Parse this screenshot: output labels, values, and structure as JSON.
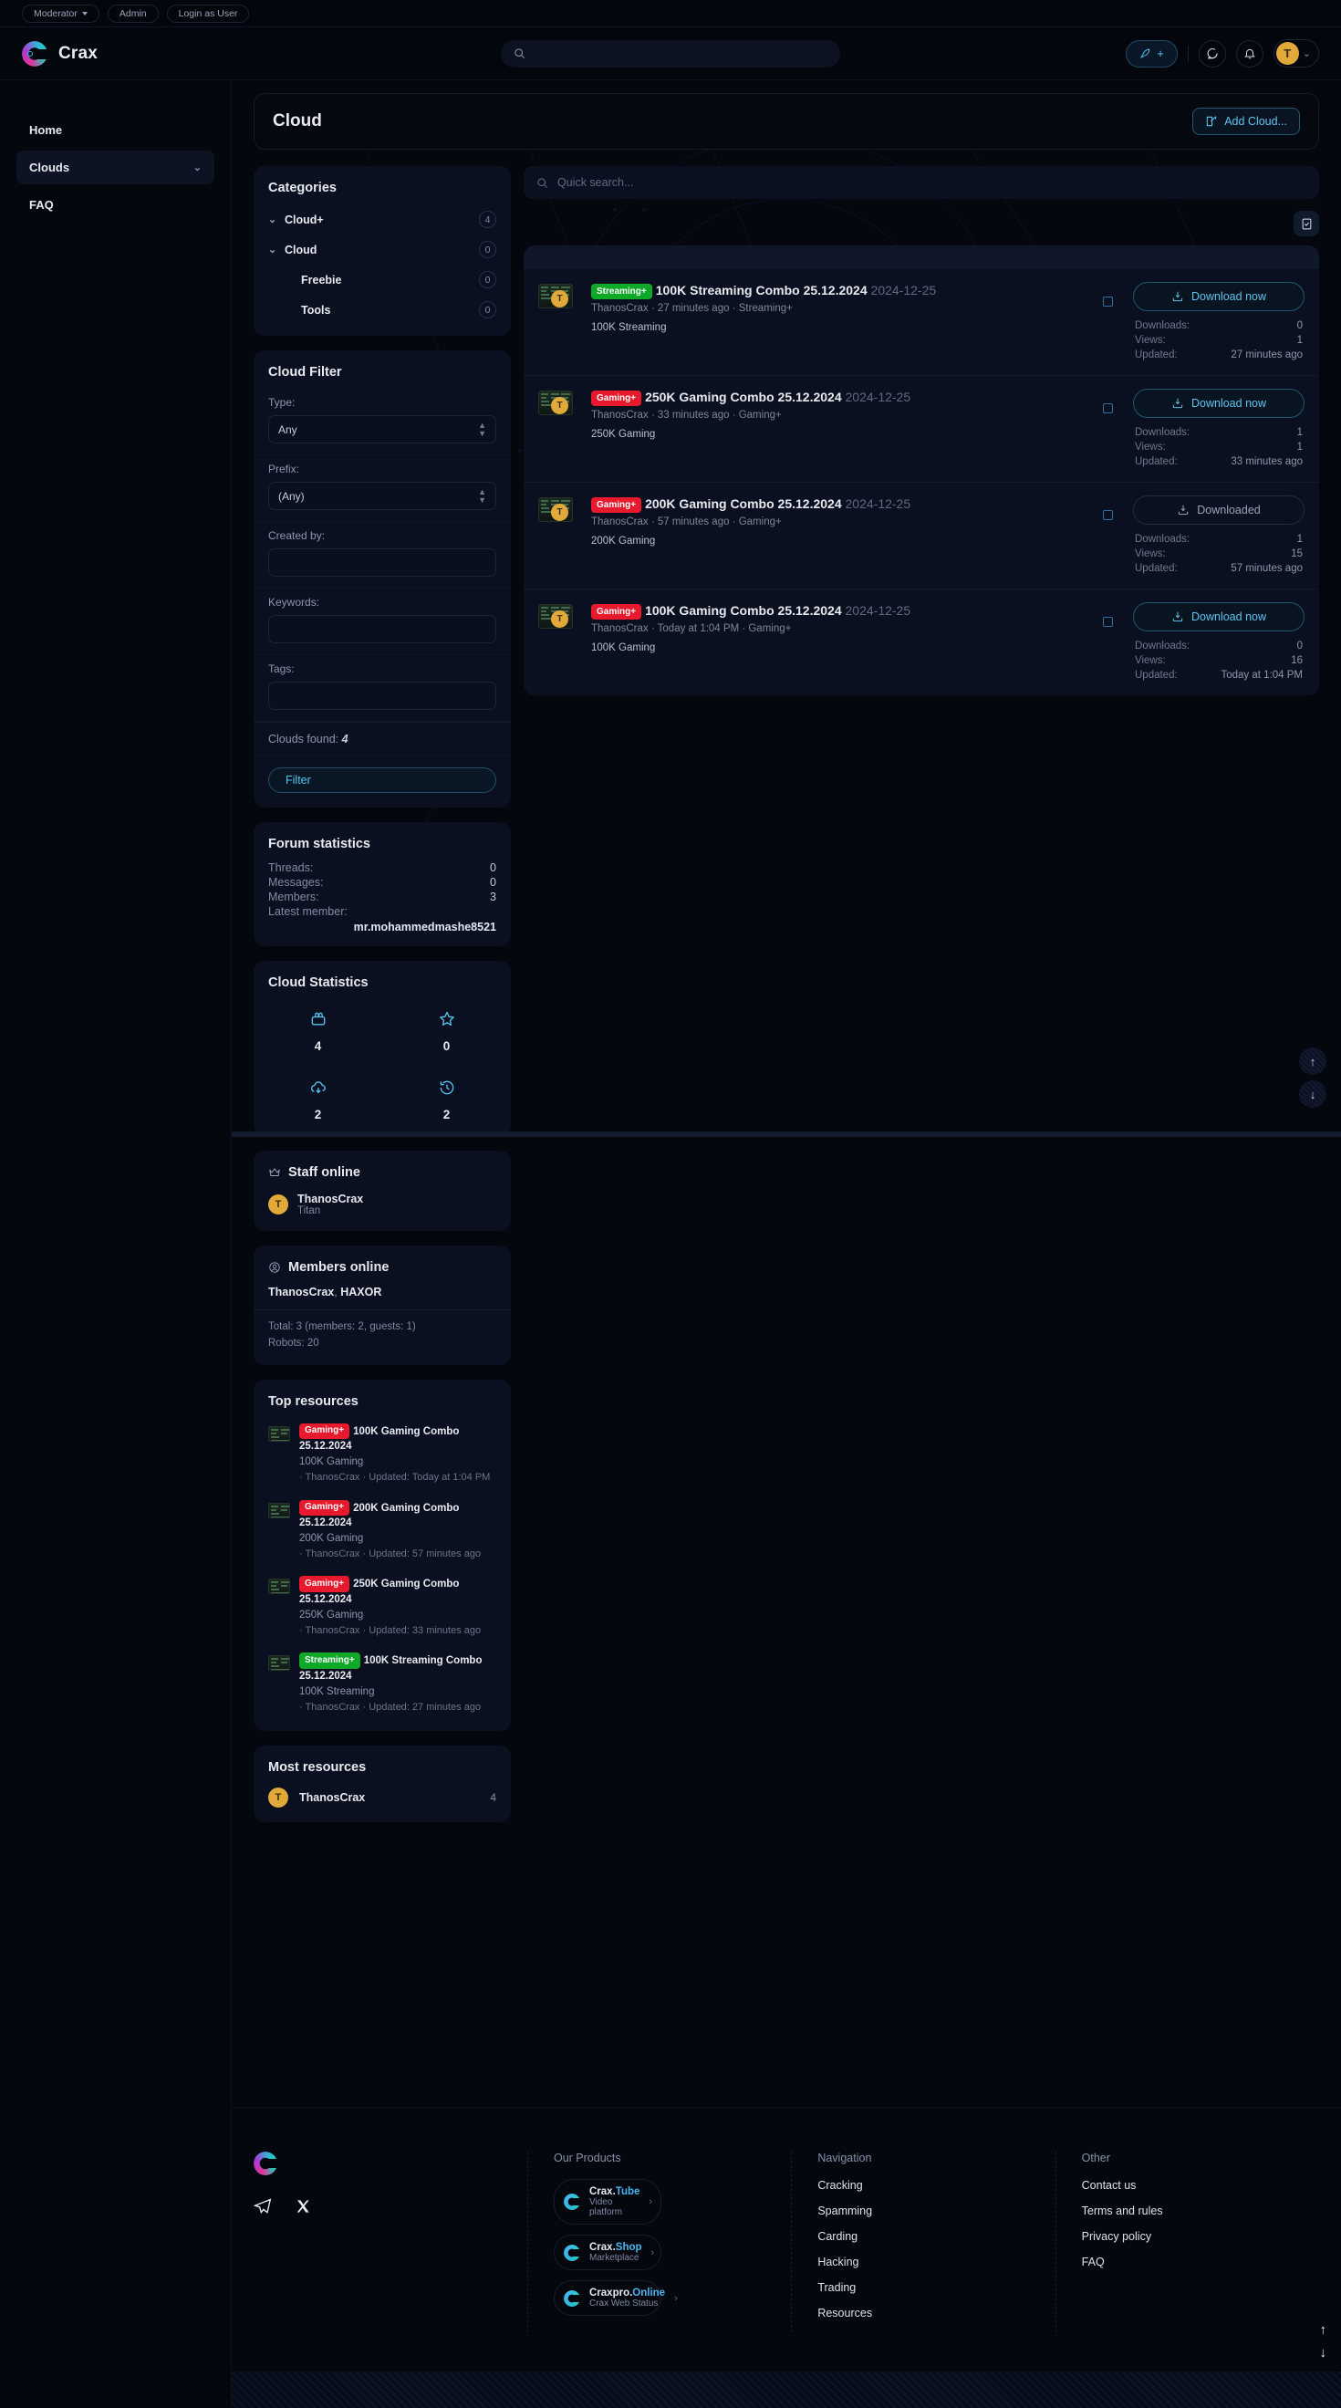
{
  "staffbar": {
    "items": [
      {
        "label": "Moderator",
        "has_caret": true
      },
      {
        "label": "Admin",
        "has_caret": false
      },
      {
        "label": "Login as User",
        "has_caret": false
      }
    ]
  },
  "header": {
    "brand": "Crax",
    "search_placeholder": "",
    "post_label": "+",
    "avatar_initial": "T"
  },
  "nav": {
    "items": [
      {
        "label": "Home",
        "active": false,
        "chevron": false
      },
      {
        "label": "Clouds",
        "active": true,
        "chevron": true
      },
      {
        "label": "FAQ",
        "active": false,
        "chevron": false
      }
    ]
  },
  "page": {
    "title": "Cloud",
    "add_button": "Add Cloud...",
    "quick_search_placeholder": "Quick search..."
  },
  "categories": {
    "title": "Categories",
    "items": [
      {
        "label": "Cloud+",
        "count": "4",
        "chevron": true,
        "sub": false
      },
      {
        "label": "Cloud",
        "count": "0",
        "chevron": true,
        "sub": false
      },
      {
        "label": "Freebie",
        "count": "0",
        "chevron": false,
        "sub": true
      },
      {
        "label": "Tools",
        "count": "0",
        "chevron": false,
        "sub": true
      }
    ]
  },
  "cloud_filter": {
    "title": "Cloud Filter",
    "type_label": "Type:",
    "type_value": "Any",
    "prefix_label": "Prefix:",
    "prefix_value": "(Any)",
    "created_by_label": "Created by:",
    "created_by_value": "",
    "keywords_label": "Keywords:",
    "keywords_value": "",
    "tags_label": "Tags:",
    "tags_value": "",
    "found_label": "Clouds found:",
    "found_count": "4",
    "filter_button": "Filter"
  },
  "forum_stats": {
    "title": "Forum statistics",
    "rows": [
      {
        "label": "Threads:",
        "value": "0"
      },
      {
        "label": "Messages:",
        "value": "0"
      },
      {
        "label": "Members:",
        "value": "3"
      }
    ],
    "latest_label": "Latest member:",
    "latest_name": "mr.mohammedmashe8521"
  },
  "cloud_stats": {
    "title": "Cloud Statistics",
    "cells": [
      {
        "icon": "resources-icon",
        "value": "4"
      },
      {
        "icon": "star-icon",
        "value": "0"
      },
      {
        "icon": "cloud-download-icon",
        "value": "2"
      },
      {
        "icon": "history-icon",
        "value": "2"
      }
    ]
  },
  "staff_online": {
    "title": "Staff online",
    "icon": "crown-icon",
    "user": {
      "initial": "T",
      "name": "ThanosCrax",
      "title": "Titan"
    }
  },
  "members_online": {
    "title": "Members online",
    "icon": "user-circle-icon",
    "names": [
      "ThanosCrax",
      "HAXOR"
    ],
    "total_line": "Total: 3 (members: 2, guests: 1)",
    "robots_line": "Robots: 20"
  },
  "top_resources": {
    "title": "Top resources",
    "items": [
      {
        "prefix": "Gaming+",
        "prefix_type": "gaming",
        "title": "100K Gaming Combo 25.12.2024",
        "sub": "100K Gaming",
        "meta": "· ThanosCrax · Updated: Today at 1:04 PM"
      },
      {
        "prefix": "Gaming+",
        "prefix_type": "gaming",
        "title": "200K Gaming Combo 25.12.2024",
        "sub": "200K Gaming",
        "meta": "· ThanosCrax · Updated: 57 minutes ago"
      },
      {
        "prefix": "Gaming+",
        "prefix_type": "gaming",
        "title": "250K Gaming Combo 25.12.2024",
        "sub": "250K Gaming",
        "meta": "· ThanosCrax · Updated: 33 minutes ago"
      },
      {
        "prefix": "Streaming+",
        "prefix_type": "streaming",
        "title": "100K Streaming Combo 25.12.2024",
        "sub": "100K Streaming",
        "meta": "· ThanosCrax · Updated: 27 minutes ago"
      }
    ]
  },
  "most_resources": {
    "title": "Most resources",
    "user": {
      "initial": "T",
      "name": "ThanosCrax",
      "count": "4"
    }
  },
  "resources": {
    "downloads_label": "Downloads:",
    "views_label": "Views:",
    "updated_label": "Updated:",
    "items": [
      {
        "prefix": "Streaming+",
        "prefix_type": "streaming",
        "title": "100K Streaming Combo 25.12.2024",
        "date": "2024-12-25",
        "sub": "ThanosCrax · 27 minutes ago · Streaming+",
        "desc": "100K Streaming",
        "button": "Download now",
        "button_state": "active",
        "avatar": "T",
        "downloads": "0",
        "views": "1",
        "updated": "27 minutes ago"
      },
      {
        "prefix": "Gaming+",
        "prefix_type": "gaming",
        "title": "250K Gaming Combo 25.12.2024",
        "date": "2024-12-25",
        "sub": "ThanosCrax · 33 minutes ago · Gaming+",
        "desc": "250K Gaming",
        "button": "Download now",
        "button_state": "active",
        "avatar": "T",
        "downloads": "1",
        "views": "1",
        "updated": "33 minutes ago"
      },
      {
        "prefix": "Gaming+",
        "prefix_type": "gaming",
        "title": "200K Gaming Combo 25.12.2024",
        "date": "2024-12-25",
        "sub": "ThanosCrax · 57 minutes ago · Gaming+",
        "desc": "200K Gaming",
        "button": "Downloaded",
        "button_state": "done",
        "avatar": "T",
        "downloads": "1",
        "views": "15",
        "updated": "57 minutes ago"
      },
      {
        "prefix": "Gaming+",
        "prefix_type": "gaming",
        "title": "100K Gaming Combo 25.12.2024",
        "date": "2024-12-25",
        "sub": "ThanosCrax · Today at 1:04 PM · Gaming+",
        "desc": "100K Gaming",
        "button": "Download now",
        "button_state": "active",
        "avatar": "T",
        "downloads": "0",
        "views": "16",
        "updated": "Today at 1:04 PM"
      }
    ]
  },
  "footer": {
    "products_heading": "Our Products",
    "products": [
      {
        "name": "Crax.",
        "accent": "Tube",
        "sub": "Video platform"
      },
      {
        "name": "Crax.",
        "accent": "Shop",
        "sub": "Marketplace"
      },
      {
        "name": "Craxpro.",
        "accent": "Online",
        "sub": "Crax Web Status"
      }
    ],
    "nav_heading": "Navigation",
    "nav_links": [
      "Cracking",
      "Spamming",
      "Carding",
      "Hacking",
      "Trading",
      "Resources"
    ],
    "other_heading": "Other",
    "other_links": [
      "Contact us",
      "Terms and rules",
      "Privacy policy",
      "FAQ"
    ]
  },
  "colors": {
    "accent": "#56c2f0",
    "gaming": "#e8192c",
    "streaming": "#10a828",
    "avatar": "#e0a93a"
  }
}
